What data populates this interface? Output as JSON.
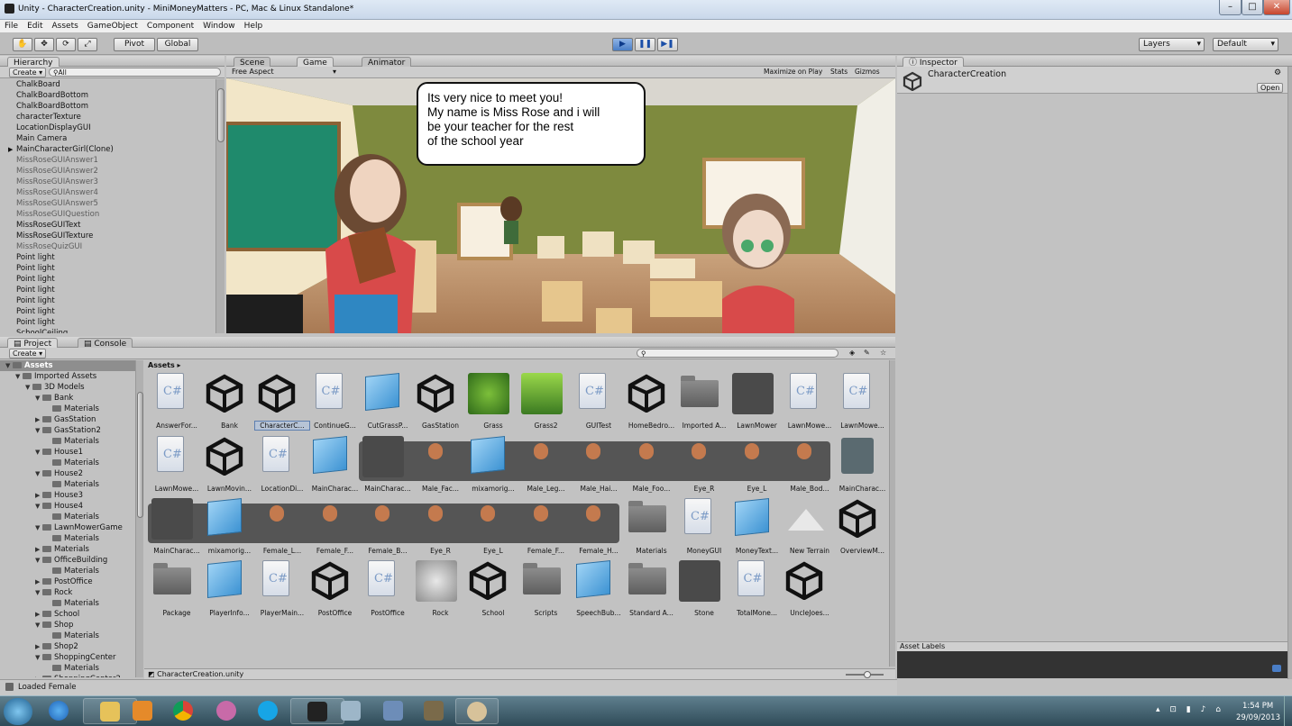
{
  "window": {
    "title": "Unity - CharacterCreation.unity - MiniMoneyMatters - PC, Mac & Linux Standalone*"
  },
  "menu": [
    "File",
    "Edit",
    "Assets",
    "GameObject",
    "Component",
    "Window",
    "Help"
  ],
  "toolbar": {
    "pivot": "Pivot",
    "global": "Global",
    "layers": "Layers",
    "layout": "Default"
  },
  "hierarchy": {
    "tab": "Hierarchy",
    "create": "Create",
    "search": "All",
    "items": [
      {
        "t": "ChalkBoard"
      },
      {
        "t": "ChalkBoardBottom"
      },
      {
        "t": "ChalkBoardBottom"
      },
      {
        "t": "characterTexture"
      },
      {
        "t": "LocationDisplayGUI"
      },
      {
        "t": "Main Camera"
      },
      {
        "t": "MainCharacterGirl(Clone)"
      },
      {
        "t": "MissRoseGUIAnswer1"
      },
      {
        "t": "MissRoseGUIAnswer2"
      },
      {
        "t": "MissRoseGUIAnswer3"
      },
      {
        "t": "MissRoseGUIAnswer4"
      },
      {
        "t": "MissRoseGUIAnswer5"
      },
      {
        "t": "MissRoseGUIQuestion"
      },
      {
        "t": "MissRoseGUIText"
      },
      {
        "t": "MissRoseGUITexture"
      },
      {
        "t": "MissRoseQuizGUI"
      },
      {
        "t": "Point light"
      },
      {
        "t": "Point light"
      },
      {
        "t": "Point light"
      },
      {
        "t": "Point light"
      },
      {
        "t": "Point light"
      },
      {
        "t": "Point light"
      },
      {
        "t": "Point light"
      },
      {
        "t": "SchoolCeiling"
      }
    ]
  },
  "view_tabs": {
    "scene": "Scene",
    "game": "Game",
    "animator": "Animator",
    "aspect": "Free Aspect",
    "maximize": "Maximize on Play",
    "stats": "Stats",
    "gizmos": "Gizmos"
  },
  "game": {
    "bubble_lines": [
      "Its very nice to meet you!",
      "My name is Miss Rose and i will",
      "be your teacher for the rest",
      "of the school year"
    ]
  },
  "inspector": {
    "tab": "Inspector",
    "object": "CharacterCreation",
    "open": "Open",
    "asset_labels": "Asset Labels"
  },
  "project": {
    "tab": "Project",
    "console": "Console",
    "create": "Create",
    "breadcrumb": "Assets",
    "tree": [
      {
        "t": "Assets",
        "d": 0,
        "o": true
      },
      {
        "t": "Imported Assets",
        "d": 1,
        "o": true
      },
      {
        "t": "3D Models",
        "d": 2,
        "o": true
      },
      {
        "t": "Bank",
        "d": 3,
        "o": true
      },
      {
        "t": "Materials",
        "d": 4
      },
      {
        "t": "GasStation",
        "d": 3
      },
      {
        "t": "GasStation2",
        "d": 3,
        "o": true
      },
      {
        "t": "Materials",
        "d": 4
      },
      {
        "t": "House1",
        "d": 3,
        "o": true
      },
      {
        "t": "Materials",
        "d": 4
      },
      {
        "t": "House2",
        "d": 3,
        "o": true
      },
      {
        "t": "Materials",
        "d": 4
      },
      {
        "t": "House3",
        "d": 3
      },
      {
        "t": "House4",
        "d": 3,
        "o": true
      },
      {
        "t": "Materials",
        "d": 4
      },
      {
        "t": "LawnMowerGame",
        "d": 3,
        "o": true
      },
      {
        "t": "Materials",
        "d": 4
      },
      {
        "t": "Materials",
        "d": 3
      },
      {
        "t": "OfficeBuilding",
        "d": 3,
        "o": true
      },
      {
        "t": "Materials",
        "d": 4
      },
      {
        "t": "PostOffice",
        "d": 3
      },
      {
        "t": "Rock",
        "d": 3,
        "o": true
      },
      {
        "t": "Materials",
        "d": 4
      },
      {
        "t": "School",
        "d": 3
      },
      {
        "t": "Shop",
        "d": 3,
        "o": true
      },
      {
        "t": "Materials",
        "d": 4
      },
      {
        "t": "Shop2",
        "d": 3
      },
      {
        "t": "ShoppingCenter",
        "d": 3,
        "o": true
      },
      {
        "t": "Materials",
        "d": 4
      },
      {
        "t": "ShoppingCenter2",
        "d": 3
      }
    ],
    "rows": [
      [
        {
          "n": "AnswerFor...",
          "k": "cs"
        },
        {
          "n": "Bank",
          "k": "unity"
        },
        {
          "n": "CharacterC...",
          "k": "unity",
          "sel": true
        },
        {
          "n": "ContinueG...",
          "k": "cs"
        },
        {
          "n": "CutGrassP...",
          "k": "cube"
        },
        {
          "n": "GasStation",
          "k": "unity"
        },
        {
          "n": "Grass",
          "k": "grass"
        },
        {
          "n": "Grass2",
          "k": "grass2"
        },
        {
          "n": "GUITest",
          "k": "cs"
        },
        {
          "n": "HomeBedro...",
          "k": "unity"
        },
        {
          "n": "Imported A...",
          "k": "folder"
        },
        {
          "n": "LawnMower",
          "k": "dark"
        },
        {
          "n": "LawnMowe...",
          "k": "cs"
        },
        {
          "n": "LawnMowe...",
          "k": "cs"
        }
      ],
      [
        {
          "n": "LawnMowe...",
          "k": "cs"
        },
        {
          "n": "LawnMovin...",
          "k": "unity"
        },
        {
          "n": "LocationDi...",
          "k": "cs"
        },
        {
          "n": "MainCharac...",
          "k": "cube"
        },
        {
          "n": "MainCharac...",
          "k": "dark"
        },
        {
          "n": "Male_Fac...",
          "k": "s"
        },
        {
          "n": "mixamorig...",
          "k": "cube"
        },
        {
          "n": "Male_Leg...",
          "k": "s"
        },
        {
          "n": "Male_Hai...",
          "k": "s"
        },
        {
          "n": "Male_Foo...",
          "k": "s"
        },
        {
          "n": "Eye_R",
          "k": "s"
        },
        {
          "n": "Eye_L",
          "k": "s"
        },
        {
          "n": "Male_Bod...",
          "k": "s"
        },
        {
          "n": "MainCharac...",
          "k": "prefab"
        }
      ],
      [
        {
          "n": "MainCharac...",
          "k": "dark"
        },
        {
          "n": "mixamorig...",
          "k": "cube"
        },
        {
          "n": "Female_L...",
          "k": "s"
        },
        {
          "n": "Female_F...",
          "k": "s"
        },
        {
          "n": "Female_B...",
          "k": "s"
        },
        {
          "n": "Eye_R",
          "k": "s"
        },
        {
          "n": "Eye_L",
          "k": "s"
        },
        {
          "n": "Female_F...",
          "k": "s"
        },
        {
          "n": "Female_H...",
          "k": "s"
        },
        {
          "n": "Materials",
          "k": "folder"
        },
        {
          "n": "MoneyGUI",
          "k": "cs"
        },
        {
          "n": "MoneyText...",
          "k": "cube"
        },
        {
          "n": "New Terrain",
          "k": "terrain"
        },
        {
          "n": "OverviewM...",
          "k": "unity"
        }
      ],
      [
        {
          "n": "Package",
          "k": "folder"
        },
        {
          "n": "PlayerInfo...",
          "k": "cube"
        },
        {
          "n": "PlayerMain...",
          "k": "cs"
        },
        {
          "n": "PostOffice",
          "k": "unity"
        },
        {
          "n": "PostOffice",
          "k": "cs"
        },
        {
          "n": "Rock",
          "k": "rock"
        },
        {
          "n": "School",
          "k": "unity"
        },
        {
          "n": "Scripts",
          "k": "folder"
        },
        {
          "n": "SpeechBub...",
          "k": "cube"
        },
        {
          "n": "Standard A...",
          "k": "folder"
        },
        {
          "n": "Stone",
          "k": "dark"
        },
        {
          "n": "TotalMone...",
          "k": "cs"
        },
        {
          "n": "UncleJoes...",
          "k": "unity"
        }
      ]
    ],
    "footer": "CharacterCreation.unity"
  },
  "status": {
    "text": "Loaded Female"
  },
  "clock": {
    "time": "1:54 PM",
    "date": "29/09/2013"
  }
}
